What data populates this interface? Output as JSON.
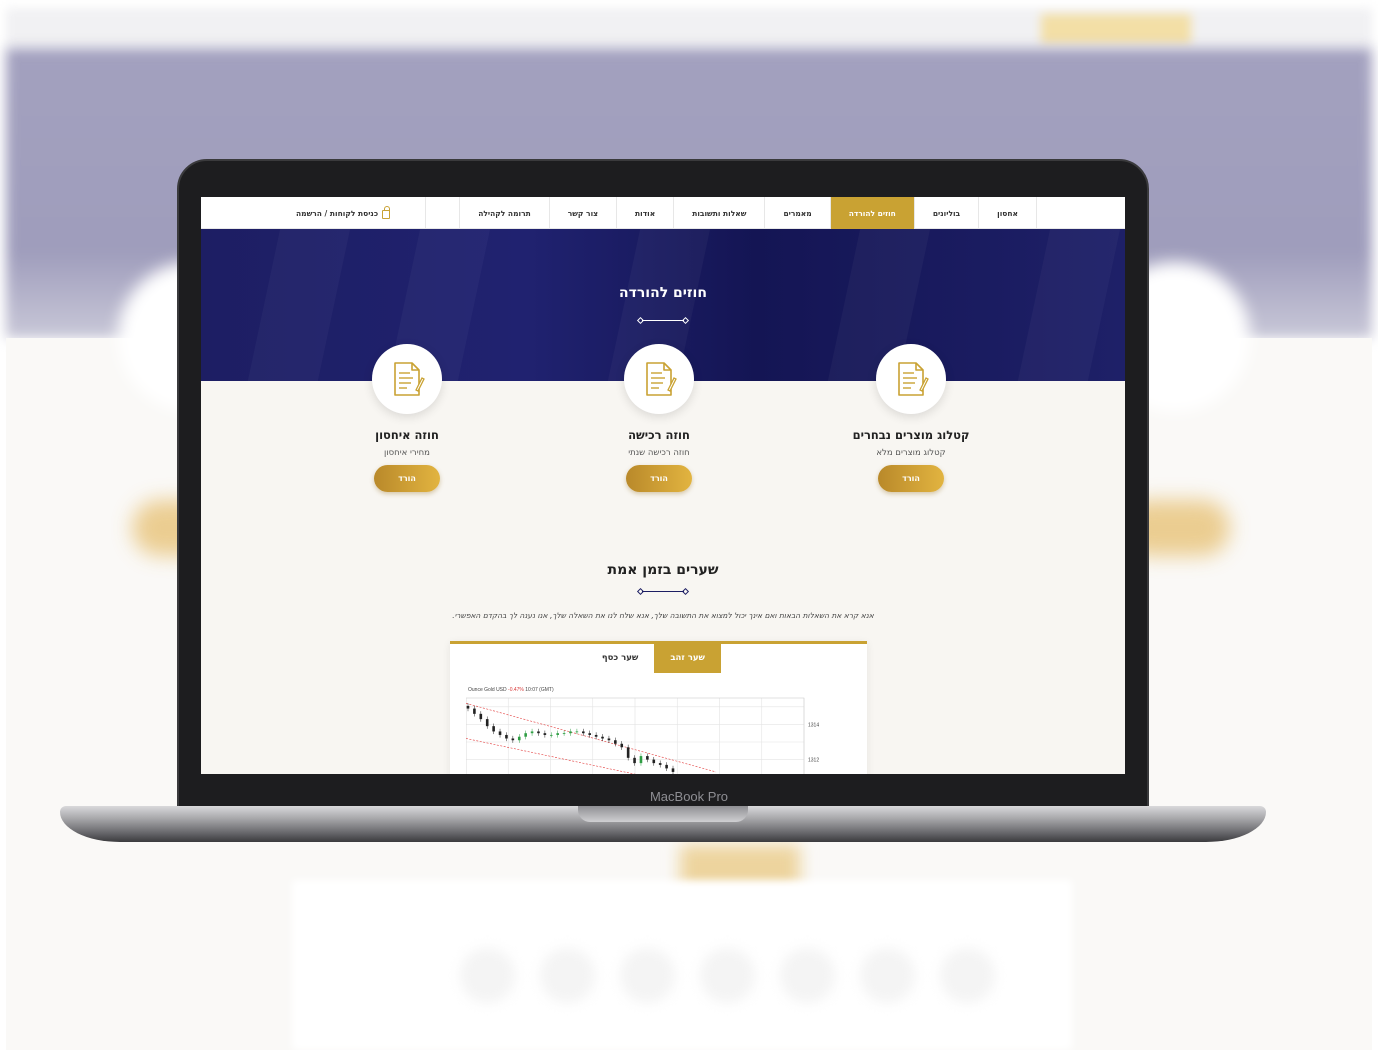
{
  "device": {
    "label": "MacBook Pro"
  },
  "nav": {
    "items": [
      {
        "label": "אחסון",
        "active": false
      },
      {
        "label": "בוליונים",
        "active": false
      },
      {
        "label": "חוזים להורדה",
        "active": true
      },
      {
        "label": "מאמרים",
        "active": false
      },
      {
        "label": "שאלות ותשובות",
        "active": false
      },
      {
        "label": "אודות",
        "active": false
      },
      {
        "label": "צור קשר",
        "active": false
      },
      {
        "label": "תרומה לקהילה",
        "active": false
      }
    ],
    "login": {
      "label": "כניסת לקוחות / הרשמה",
      "icon": "lock-icon"
    }
  },
  "hero": {
    "title": "חוזים להורדה"
  },
  "cards": [
    {
      "title": "קטלוג מוצרים נבחרים",
      "subtitle": "קטלוג מוצרים מלא",
      "button": "הורד",
      "icon": "document-icon"
    },
    {
      "title": "חוזה רכישה",
      "subtitle": "חוזה רכישה שנתי",
      "button": "הורד",
      "icon": "document-icon"
    },
    {
      "title": "חוזה איחסון",
      "subtitle": "מחירי איחסון",
      "button": "הורד",
      "icon": "document-icon"
    }
  ],
  "rates": {
    "title": "שערים בזמן אמת",
    "description": "אנא קרא את השאלות הבאות ואם אינך יכול למצוא את התשובה שלך, אנא שלח לנו את השאלה שלך, אנו נענה לך בהקדם האפשרי.",
    "tabs": [
      {
        "label": "שער זהב",
        "active": true
      },
      {
        "label": "שער כסף",
        "active": false
      }
    ]
  },
  "chart_data": {
    "type": "line",
    "caption_prefix": "Ounce Gold USD",
    "caption_change": "-0.47%",
    "caption_time": "10:07 (GMT)",
    "y_ticks": [
      "1314",
      "1312"
    ],
    "ylim": [
      1310.5,
      1315.5
    ],
    "series": [
      {
        "values": [
          1314.9,
          1314.6,
          1314.3,
          1313.9,
          1313.6,
          1313.4,
          1313.2,
          1313.1,
          1313.3,
          1313.5,
          1313.6,
          1313.5,
          1313.4,
          1313.4,
          1313.5,
          1313.5,
          1313.6,
          1313.6,
          1313.5,
          1313.4,
          1313.3,
          1313.2,
          1313.1,
          1312.9,
          1312.7,
          1312.1,
          1311.8,
          1312.2,
          1312.0,
          1311.8,
          1311.7,
          1311.5,
          1311.3
        ]
      }
    ],
    "colors": {
      "up": "#2f9e44",
      "down": "#222222",
      "trend": "#e23a3a"
    }
  },
  "colors": {
    "gold": "#c9a233",
    "navy": "#1d1e63",
    "background": "#f8f6f2"
  }
}
